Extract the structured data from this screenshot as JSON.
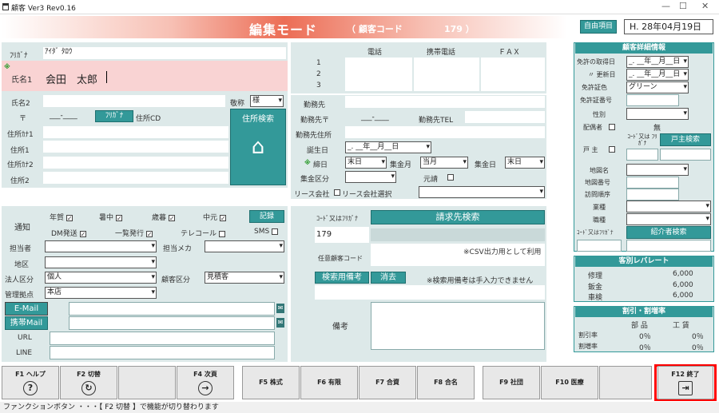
{
  "window": {
    "title": "顧客 Ver3 Rev0.16",
    "min": "—",
    "max": "☐",
    "close": "✕"
  },
  "header": {
    "mode_title": "編集モード",
    "cust_code_label": "（ 顧客コード",
    "cust_code_value": "179 ）",
    "free_item_label": "自由項目",
    "date_value": "H. 28年04月19日"
  },
  "basic": {
    "kana_label": "ﾌﾘｶﾞﾅ",
    "kana_value": "ｱｲﾀﾞ ﾀﾛｳ",
    "name1_mark": "※",
    "name1_label": "氏名1",
    "name1_value": "会田　太郎",
    "name2_label": "氏名2",
    "honorific_label": "敬称",
    "honorific_value": "様",
    "zip_label": "〒",
    "zip_value": "___-____",
    "furigana_btn": "ﾌﾘｶﾞﾅ",
    "addr_cd_label": "住所CD",
    "addr_search_btn": "住所検索",
    "addr_kana1_label": "住所ｶﾅ1",
    "addr1_label": "住所1",
    "addr_kana2_label": "住所ｶﾅ2",
    "addr2_label": "住所2"
  },
  "phones": {
    "col_tel": "電話",
    "col_mobile": "携帯電話",
    "col_fax": "ＦＡＸ",
    "rows": [
      "1",
      "2",
      "3"
    ]
  },
  "work": {
    "company_label": "勤務先",
    "zip_label": "勤務先〒",
    "zip_value": "___-____",
    "tel_label": "勤務先TEL",
    "addr_label": "勤務先住所",
    "birthday_label": "誕生日",
    "birthday_value": "_. __年__月__日",
    "close_mark": "※",
    "close_label": "締日",
    "close_value": "末日",
    "collect_month_label": "集金月",
    "collect_month_value": "当月",
    "collect_day_label": "集金日",
    "collect_day_value": "末日",
    "collect_cat_label": "集金区分",
    "gensei_label": "元請",
    "lease_label": "リース会社",
    "lease_select_label": "リース会社選択"
  },
  "notice": {
    "label": "通知",
    "record_btn": "記録",
    "checks": [
      {
        "label": "年賀",
        "checked": true
      },
      {
        "label": "暑中",
        "checked": true
      },
      {
        "label": "歳暮",
        "checked": true
      },
      {
        "label": "中元",
        "checked": true
      },
      {
        "label": "DM発送",
        "checked": true
      },
      {
        "label": "一覧発行",
        "checked": true
      },
      {
        "label": "テレコール",
        "checked": false
      },
      {
        "label": "SMS",
        "checked": false
      }
    ]
  },
  "staff": {
    "tantou_label": "担当者",
    "maker_label": "担当メカ",
    "area_label": "地区",
    "corp_label": "法人区分",
    "corp_value": "個人",
    "cust_cat_label": "顧客区分",
    "cust_cat_value": "見積客",
    "base_label": "管理拠点",
    "base_value": "本店",
    "email_btn": "E-Mail",
    "mobile_mail_btn": "携帯Mail",
    "url_label": "URL",
    "line_label": "LINE"
  },
  "billing": {
    "code_kana_label": "ｺｰﾄﾞ又はﾌﾘｶﾞﾅ",
    "search_btn": "請求先検索",
    "code_value": "179",
    "opt_code_label": "任意顧客コード",
    "csv_note": "※CSV出力用として利用",
    "search_memo_btn": "検索用備考",
    "delete_btn": "消去",
    "memo_note": "※検索用備考は手入力できません",
    "memo_label": "備考"
  },
  "details": {
    "title": "顧客詳細情報",
    "license_date_label": "免許の取得日",
    "license_date_value": "_. __年__月__日",
    "renew_label": "〃 更新日",
    "renew_value": "_. __年__月__日",
    "license_color_label": "免許証色",
    "license_color_value": "グリーン",
    "license_no_label": "免許証番号",
    "sex_label": "性別",
    "spouse_label": "配偶者",
    "status_value": "無",
    "head_label": "戸 主",
    "code_kana_label": "ｺｰﾄﾞ又は ﾌﾘｶﾞﾅ",
    "head_search_btn": "戸主検索",
    "map_name_label": "地図名",
    "map_no_label": "地図番号",
    "visit_label": "訪問順序",
    "industry_label": "業種",
    "job_label": "職種",
    "intro_code_label": "ｺｰﾄﾞ又はﾌﾘｶﾞﾅ",
    "intro_search_btn": "紹介者検索"
  },
  "rates": {
    "title": "客別レバレート",
    "rows": [
      {
        "label": "修理",
        "value": "6,000"
      },
      {
        "label": "鈑金",
        "value": "6,000"
      },
      {
        "label": "車検",
        "value": "6,000"
      }
    ]
  },
  "discount": {
    "title": "割引・割増率",
    "col_parts": "部 品",
    "col_labor": "工 賃",
    "rows": [
      {
        "label": "割引率",
        "parts": "0％",
        "labor": "0％"
      },
      {
        "label": "割増率",
        "parts": "0％",
        "labor": "0％"
      }
    ]
  },
  "fkeys": [
    {
      "label": "F1 ヘルプ",
      "icon": "?"
    },
    {
      "label": "F2 切替",
      "icon": "↻"
    },
    {
      "label": "",
      "icon": ""
    },
    {
      "label": "F4 次頁",
      "icon": "→"
    },
    {
      "label": "F5 株式",
      "icon": ""
    },
    {
      "label": "F6 有限",
      "icon": ""
    },
    {
      "label": "F7 合資",
      "icon": ""
    },
    {
      "label": "F8 合名",
      "icon": ""
    },
    {
      "label": "F9 社団",
      "icon": ""
    },
    {
      "label": "F10 医療",
      "icon": ""
    },
    {
      "label": "",
      "icon": ""
    },
    {
      "label": "F12 終了",
      "icon": "⇥"
    }
  ],
  "status": {
    "text": "ファンクションボタン ・・・【 F2 切替 】で機能が切り替わります"
  },
  "colors": {
    "teal": "#339999",
    "red": "#ec6d55",
    "pink": "#f9d3d3",
    "highlight": "#ff0000"
  }
}
